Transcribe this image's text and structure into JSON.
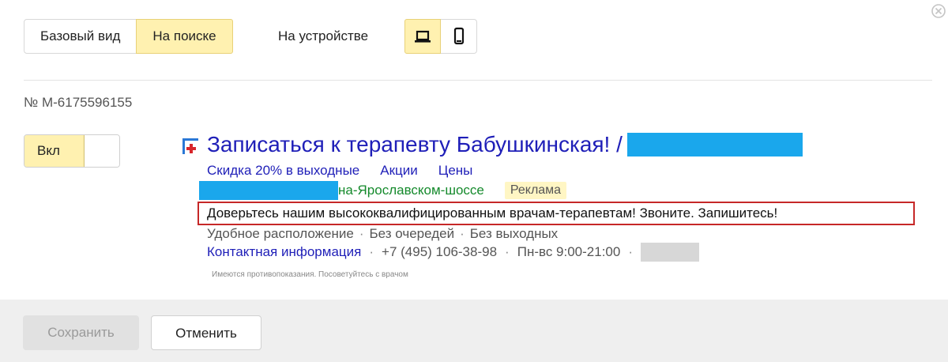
{
  "view_switch": {
    "options": [
      {
        "label": "Базовый вид"
      },
      {
        "label": "На поиске"
      }
    ],
    "selected": "На поиске"
  },
  "device": {
    "label": "На устройстве",
    "options": [
      {
        "icon": "laptop-icon",
        "active": true
      },
      {
        "icon": "phone-icon",
        "active": false
      }
    ]
  },
  "ad_number": "№ M-6175596155",
  "toggle": {
    "label": "Вкл",
    "state": "on"
  },
  "ad": {
    "title": "Записаться к терапевту Бабушкинская! /",
    "sitelinks": [
      "Скидка 20% в выходные",
      "Акции",
      "Цены"
    ],
    "url_tail": "на-Ярославском-шоссе",
    "badge": "Реклама",
    "text": "Доверьтесь нашим высококвалифицированным врачам-терапевтам! Звоните. Запишитесь!",
    "callouts": [
      "Удобное расположение",
      "Без очередей",
      "Без выходных"
    ],
    "contact_link": "Контактная информация",
    "phone": "+7 (495) 106-38-98",
    "hours": "Пн-вс 9:00-21:00",
    "warning": "Имеются противопоказания. Посоветуйтесь с врачом"
  },
  "footer": {
    "save_label": "Сохранить",
    "cancel_label": "Отменить"
  },
  "colors": {
    "accent_yellow": "#fff1b0",
    "link_blue": "#1f1fb8",
    "url_green": "#158a2c",
    "highlight_red": "#c62828",
    "redaction_blue": "#1aa7ec"
  }
}
